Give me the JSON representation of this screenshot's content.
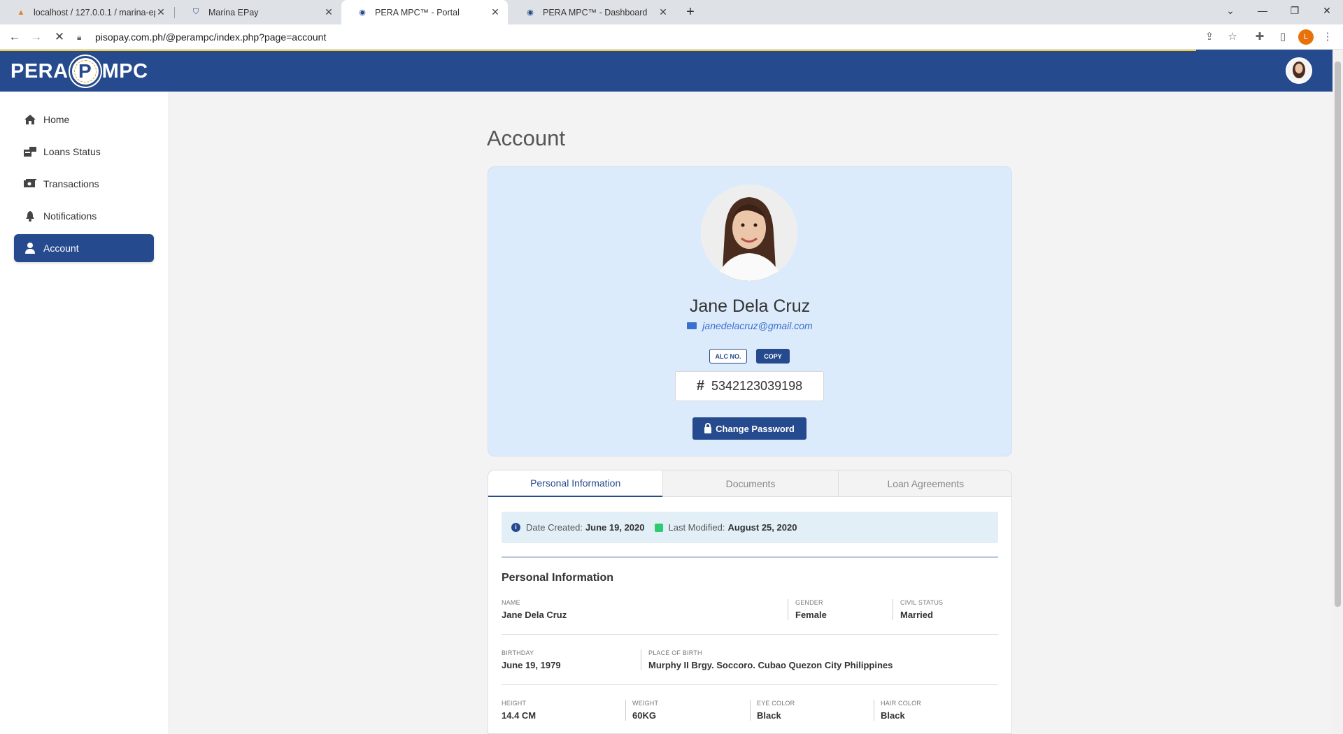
{
  "browser": {
    "tabs": [
      {
        "title": "localhost / 127.0.0.1 / marina-ep",
        "icon": "phpmyadmin-icon"
      },
      {
        "title": "Marina EPay",
        "icon": "shield-icon"
      },
      {
        "title": "PERA MPC™ - Portal",
        "icon": "pera-icon"
      },
      {
        "title": "PERA MPC™ - Dashboard",
        "icon": "pera-icon"
      }
    ],
    "active_tab_index": 2,
    "url": "pisopay.com.ph/@perampc/index.php?page=account",
    "profile_initial": "L"
  },
  "app": {
    "logo_left": "PERA",
    "logo_seal": "P",
    "logo_right": "MPC",
    "brand_color": "#264a8e"
  },
  "sidebar": {
    "items": [
      {
        "label": "Home",
        "icon": "home-icon",
        "active": false
      },
      {
        "label": "Loans Status",
        "icon": "loans-icon",
        "active": false
      },
      {
        "label": "Transactions",
        "icon": "money-icon",
        "active": false
      },
      {
        "label": "Notifications",
        "icon": "bell-icon",
        "active": false
      },
      {
        "label": "Account",
        "icon": "user-icon",
        "active": true
      }
    ]
  },
  "page": {
    "title": "Account"
  },
  "profile": {
    "name": "Jane Dela Cruz",
    "email": "janedelacruz@gmail.com",
    "alc_badge": "ALC NO.",
    "copy_badge": "COPY",
    "account_number": "5342123039198",
    "change_password_label": "Change Password"
  },
  "details": {
    "tabs": [
      "Personal Information",
      "Documents",
      "Loan Agreements"
    ],
    "active_tab": 0,
    "date_created_label": "Date Created:",
    "date_created": "June 19, 2020",
    "last_modified_label": "Last Modified:",
    "last_modified": "August 25, 2020",
    "section_title": "Personal Information",
    "name_label": "NAME",
    "name": "Jane Dela Cruz",
    "gender_label": "GENDER",
    "gender": "Female",
    "civil_status_label": "CIVIL STATUS",
    "civil_status": "Married",
    "birthday_label": "BIRTHDAY",
    "birthday": "June 19, 1979",
    "place_of_birth_label": "PLACE OF BIRTH",
    "place_of_birth": "Murphy II Brgy. Soccoro. Cubao Quezon City Philippines",
    "height_label": "HEIGHT",
    "height": "14.4 CM",
    "weight_label": "WEIGHT",
    "weight": "60KG",
    "eye_color_label": "EYE COLOR",
    "eye_color": "Black",
    "hair_color_label": "HAIR COLOR",
    "hair_color": "Black"
  }
}
